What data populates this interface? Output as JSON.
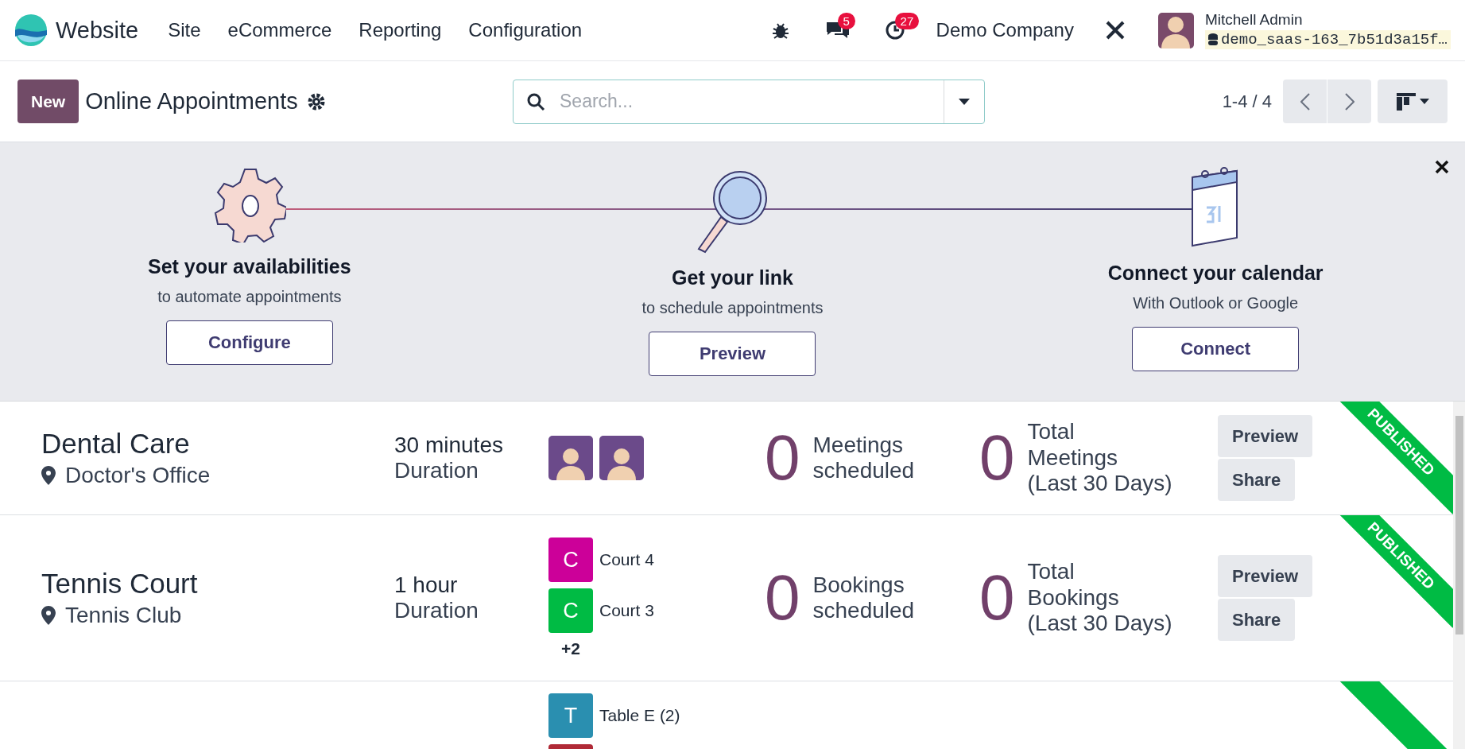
{
  "navbar": {
    "app_name": "Website",
    "menu": [
      "Site",
      "eCommerce",
      "Reporting",
      "Configuration"
    ],
    "messages_count": "5",
    "activities_count": "27",
    "company": "Demo Company",
    "user_name": "Mitchell Admin",
    "database": "demo_saas-163_7b51d3a15f…"
  },
  "control_panel": {
    "new_button": "New",
    "title": "Online Appointments",
    "search": {
      "placeholder": "Search..."
    },
    "pager": "1-4 / 4"
  },
  "onboarding": {
    "steps": [
      {
        "kind": "gear",
        "title": "Set your availabilities",
        "subtitle": "to automate appointments",
        "button": "Configure"
      },
      {
        "kind": "magnifier",
        "title": "Get your link",
        "subtitle": "to schedule appointments",
        "button": "Preview"
      },
      {
        "kind": "calendar",
        "title": "Connect your calendar",
        "subtitle": "With Outlook or Google",
        "button": "Connect"
      }
    ]
  },
  "appointments": [
    {
      "name": "Dental Care",
      "location": "Doctor's Office",
      "duration": "30 minutes",
      "duration_label": "Duration",
      "resources": [
        {
          "kind": "person"
        },
        {
          "kind": "person"
        }
      ],
      "scheduled_count": "0",
      "scheduled_lines": [
        "Meetings",
        "scheduled"
      ],
      "total_count": "0",
      "total_lines": [
        "Total",
        "Meetings",
        "(Last 30 Days)"
      ],
      "buttons": [
        "Preview",
        "Share"
      ],
      "published": true,
      "ribbon": "PUBLISHED"
    },
    {
      "name": "Tennis Court",
      "location": "Tennis Club",
      "duration": "1 hour",
      "duration_label": "Duration",
      "resources": [
        {
          "kind": "letter",
          "letter": "C",
          "label": "Court 4",
          "color": "#cc0099"
        },
        {
          "kind": "letter",
          "letter": "C",
          "label": "Court 3",
          "color": "#00bb44"
        }
      ],
      "more": "+2",
      "scheduled_count": "0",
      "scheduled_lines": [
        "Bookings",
        "scheduled"
      ],
      "total_count": "0",
      "total_lines": [
        "Total",
        "Bookings",
        "(Last 30 Days)"
      ],
      "buttons": [
        "Preview",
        "Share"
      ],
      "published": true,
      "ribbon": "PUBLISHED"
    },
    {
      "resources": [
        {
          "kind": "letter",
          "letter": "T",
          "label": "Table E (2)",
          "color": "#2a8fb0"
        },
        {
          "kind": "letter",
          "color": "#b02a37"
        }
      ],
      "published": true
    }
  ]
}
